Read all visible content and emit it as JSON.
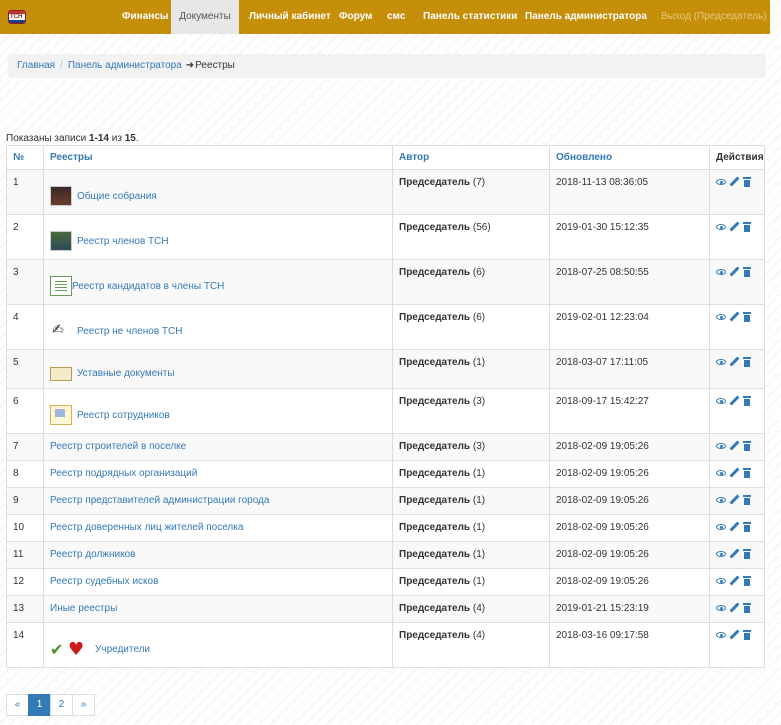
{
  "nav": {
    "brand_text": "ТСН",
    "items": [
      "Финансы",
      "Документы",
      "Личный кабинет",
      "Форум",
      "смс",
      "Панель статистики",
      "Панель администратора"
    ],
    "logout": "Выход (Председатель)"
  },
  "breadcrumb": {
    "home": "Главная",
    "admin": "Панель администратора",
    "arrow": "➜",
    "current": "Реестры"
  },
  "summary": {
    "prefix": "Показаны записи ",
    "range": "1-14",
    "of": " из ",
    "total": "15",
    "suffix": "."
  },
  "table": {
    "headers": {
      "num": "№",
      "name": "Реестры",
      "author": "Автор",
      "updated": "Обновлено",
      "actions": "Действия"
    },
    "rows": [
      {
        "num": "1",
        "name": "Общие собрания",
        "author": "Председатель",
        "count": "(7)",
        "updated": "2018-11-13 08:36:05",
        "thumb": "meeting-photo-icon"
      },
      {
        "num": "2",
        "name": "Реестр членов ТСН",
        "author": "Председатель",
        "count": "(56)",
        "updated": "2019-01-30 15:12:35",
        "thumb": "members-photo-icon"
      },
      {
        "num": "3",
        "name": "Реестр кандидатов в члены ТСН",
        "author": "Председатель",
        "count": "(6)",
        "updated": "2018-07-25 08:50:55",
        "thumb": "document-list-icon"
      },
      {
        "num": "4",
        "name": "Реестр не членов ТСН",
        "author": "Председатель",
        "count": "(6)",
        "updated": "2019-02-01 12:23:04",
        "thumb": "sketch-icon"
      },
      {
        "num": "5",
        "name": "Уставные документы",
        "author": "Председатель",
        "count": "(1)",
        "updated": "2018-03-07 17:11:05",
        "thumb": "certificate-icon"
      },
      {
        "num": "6",
        "name": "Реестр сотрудников",
        "author": "Председатель",
        "count": "(3)",
        "updated": "2018-09-17 15:42:27",
        "thumb": "staff-icon"
      },
      {
        "num": "7",
        "name": "Реестр строителей в поселке",
        "author": "Председатель",
        "count": "(3)",
        "updated": "2018-02-09 19:05:26"
      },
      {
        "num": "8",
        "name": "Реестр подрядных организаций",
        "author": "Председатель",
        "count": "(1)",
        "updated": "2018-02-09 19:05:26"
      },
      {
        "num": "9",
        "name": "Реестр представителей администрации города",
        "author": "Председатель",
        "count": "(1)",
        "updated": "2018-02-09 19:05:26"
      },
      {
        "num": "10",
        "name": "Реестр доверенных лиц жителей поселка",
        "author": "Председатель",
        "count": "(1)",
        "updated": "2018-02-09 19:05:26"
      },
      {
        "num": "11",
        "name": "Реестр должников",
        "author": "Председатель",
        "count": "(1)",
        "updated": "2018-02-09 19:05:26"
      },
      {
        "num": "12",
        "name": "Реестр судебных исков",
        "author": "Председатель",
        "count": "(1)",
        "updated": "2018-02-09 19:05:26"
      },
      {
        "num": "13",
        "name": "Иные реестры",
        "author": "Председатель",
        "count": "(4)",
        "updated": "2019-01-21 15:23:19"
      },
      {
        "num": "14",
        "name": "Учредители",
        "author": "Председатель",
        "count": "(4)",
        "updated": "2018-03-16 09:17:58",
        "thumb": "check-heart-icon"
      }
    ]
  },
  "pagination": [
    "«",
    "1",
    "2",
    "»"
  ],
  "colors": {
    "navbar": "#c58f0a",
    "link": "#337ab7",
    "active_page": "#337ab7"
  }
}
